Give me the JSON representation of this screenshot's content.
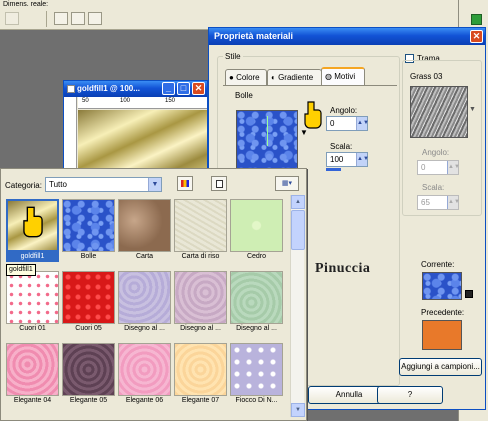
{
  "toolbar": {
    "label": "Dimens. reale:"
  },
  "child_window": {
    "title": "goldfill1 @ 100...",
    "ruler_marks": [
      "50",
      "100",
      "150"
    ]
  },
  "dialog": {
    "title": "Proprietà materiali",
    "stile_label": "Stile",
    "tabs": [
      {
        "label": "Colore"
      },
      {
        "label": "Gradiente"
      },
      {
        "label": "Motivi"
      }
    ],
    "pattern_name": "Bolle",
    "angle_label": "Angolo:",
    "angle_value": "0",
    "scale_label": "Scala:",
    "scale_value": "100",
    "trama_label": "Trama",
    "texture_name": "Grass 03",
    "texture_angle_label": "Angolo:",
    "texture_angle_value": "0",
    "texture_scale_label": "Scala:",
    "texture_scale_value": "65",
    "corrente_label": "Corrente:",
    "precedente_label": "Precedente:",
    "add_samples_label": "Aggiungi a campioni...",
    "annulla_label": "Annulla",
    "help_label": "?",
    "watermark": "Pinuccia",
    "colors": {
      "corrente": "#2a52c8",
      "precedente": "#e8792a",
      "accent": "#f5a623"
    }
  },
  "picker": {
    "category_label": "Categoria:",
    "category_value": "Tutto",
    "tooltip": "goldfill1",
    "items": [
      {
        "label": "goldfill1"
      },
      {
        "label": "Bolle"
      },
      {
        "label": "Carta"
      },
      {
        "label": "Carta di riso"
      },
      {
        "label": "Cedro"
      },
      {
        "label": "Cuori 01"
      },
      {
        "label": "Cuori 05"
      },
      {
        "label": "Disegno al ..."
      },
      {
        "label": "Disegno al ..."
      },
      {
        "label": "Disegno al ..."
      },
      {
        "label": "Elegante 04"
      },
      {
        "label": "Elegante 05"
      },
      {
        "label": "Elegante 06"
      },
      {
        "label": "Elegante 07"
      },
      {
        "label": "Fiocco Di N..."
      }
    ]
  }
}
